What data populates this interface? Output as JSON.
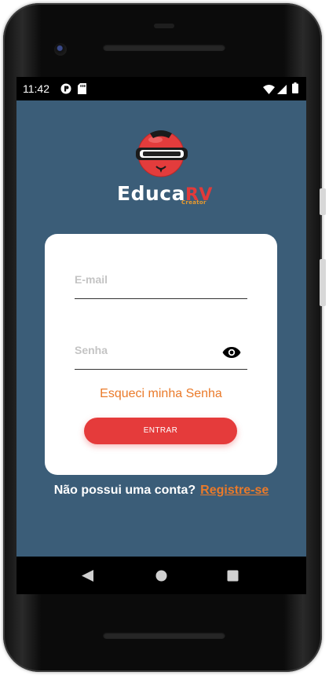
{
  "status_bar": {
    "time": "11:42",
    "icons": [
      "notification-icon",
      "sd-card-icon",
      "wifi-icon",
      "cell-signal-icon",
      "battery-icon"
    ]
  },
  "brand": {
    "name_main": "Educa",
    "name_accent": "RV",
    "tagline": "Creator",
    "accent_color": "#e23a3a",
    "tagline_color": "#e99a2c"
  },
  "login_form": {
    "email_placeholder": "E-mail",
    "password_placeholder": "Senha",
    "forgot_password": "Esqueci minha Senha",
    "submit_label": "ENTRAR",
    "submit_color": "#e53b3b",
    "link_color": "#ea7a2a"
  },
  "signup": {
    "prompt": "Não possui uma conta?",
    "link": "Registre-se"
  },
  "nav_bar": {
    "icons": [
      "back-icon",
      "home-icon",
      "recents-icon"
    ]
  },
  "theme": {
    "background": "#3b5d78"
  }
}
